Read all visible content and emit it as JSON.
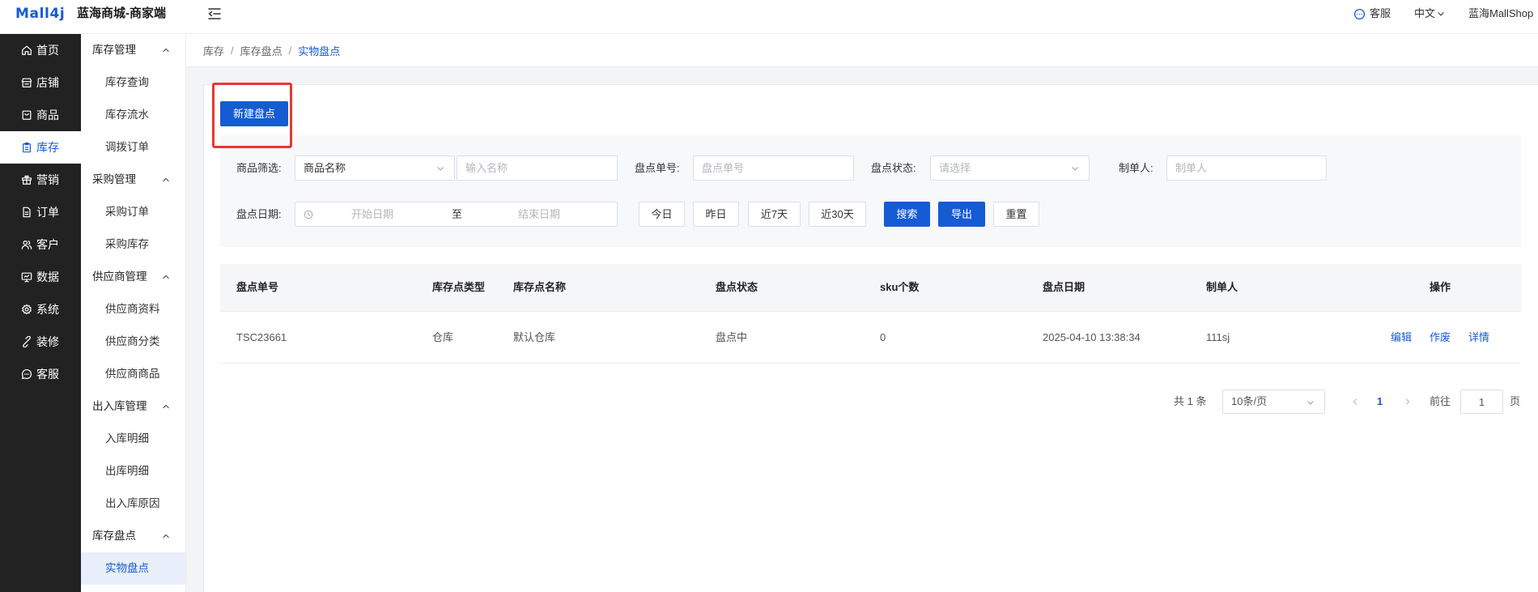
{
  "header": {
    "logo": "Mall4j",
    "title": "蓝海商城-商家端",
    "service_label": "客服",
    "language_label": "中文",
    "user_name": "蓝海MallShop"
  },
  "sidebar": {
    "items": [
      {
        "label": "首页",
        "icon": "home-icon"
      },
      {
        "label": "店铺",
        "icon": "shop-icon"
      },
      {
        "label": "商品",
        "icon": "product-icon"
      },
      {
        "label": "库存",
        "icon": "inventory-icon",
        "active": true
      },
      {
        "label": "营销",
        "icon": "gift-icon"
      },
      {
        "label": "订单",
        "icon": "order-icon"
      },
      {
        "label": "客户",
        "icon": "customer-icon"
      },
      {
        "label": "数据",
        "icon": "monitor-icon"
      },
      {
        "label": "系统",
        "icon": "gear-icon"
      },
      {
        "label": "装修",
        "icon": "decoration-icon"
      },
      {
        "label": "客服",
        "icon": "chat-icon"
      }
    ]
  },
  "subnav": {
    "groups": [
      {
        "label": "库存管理",
        "expanded": true,
        "items": [
          {
            "label": "库存查询"
          },
          {
            "label": "库存流水"
          },
          {
            "label": "调拨订单"
          }
        ]
      },
      {
        "label": "采购管理",
        "expanded": true,
        "items": [
          {
            "label": "采购订单"
          },
          {
            "label": "采购库存"
          }
        ]
      },
      {
        "label": "供应商管理",
        "expanded": true,
        "items": [
          {
            "label": "供应商资料"
          },
          {
            "label": "供应商分类"
          },
          {
            "label": "供应商商品"
          }
        ]
      },
      {
        "label": "出入库管理",
        "expanded": true,
        "items": [
          {
            "label": "入库明细"
          },
          {
            "label": "出库明细"
          },
          {
            "label": "出入库原因"
          }
        ]
      },
      {
        "label": "库存盘点",
        "expanded": true,
        "items": [
          {
            "label": "实物盘点",
            "active": true
          }
        ]
      }
    ]
  },
  "breadcrumb": {
    "items": [
      "库存",
      "库存盘点",
      "实物盘点"
    ],
    "separator": "/"
  },
  "toolbar": {
    "new_button": "新建盘点"
  },
  "filters": {
    "product_filter": {
      "label": "商品筛选:",
      "select_value": "商品名称",
      "input_placeholder": "输入名称"
    },
    "stocktake_no": {
      "label": "盘点单号:",
      "placeholder": "盘点单号"
    },
    "status": {
      "label": "盘点状态:",
      "placeholder": "请选择"
    },
    "creator": {
      "label": "制单人:",
      "placeholder": "制单人"
    },
    "date": {
      "label": "盘点日期:",
      "start_placeholder": "开始日期",
      "separator": "至",
      "end_placeholder": "结束日期"
    },
    "quick_dates": [
      "今日",
      "昨日",
      "近7天",
      "近30天"
    ],
    "actions": {
      "search": "搜索",
      "export": "导出",
      "reset": "重置"
    }
  },
  "table": {
    "columns": [
      "盘点单号",
      "库存点类型",
      "库存点名称",
      "盘点状态",
      "sku个数",
      "盘点日期",
      "制单人",
      "操作"
    ],
    "rows": [
      {
        "stocktake_no": "TSC23661",
        "location_type": "仓库",
        "location_name": "默认仓库",
        "status": "盘点中",
        "sku_count": 0,
        "date": "2025-04-10 13:38:34",
        "creator": "111sj",
        "actions": [
          "编辑",
          "作废",
          "详情"
        ]
      }
    ]
  },
  "pagination": {
    "total_text": "共 1 条",
    "page_size": "10条/页",
    "current_page": "1",
    "jump_label": "前往",
    "jump_value": "1",
    "page_suffix": "页"
  },
  "colors": {
    "primary": "#155bd4",
    "highlight": "#e53935",
    "sidebar_bg": "#222222",
    "filter_bg": "#f7f8fa"
  }
}
